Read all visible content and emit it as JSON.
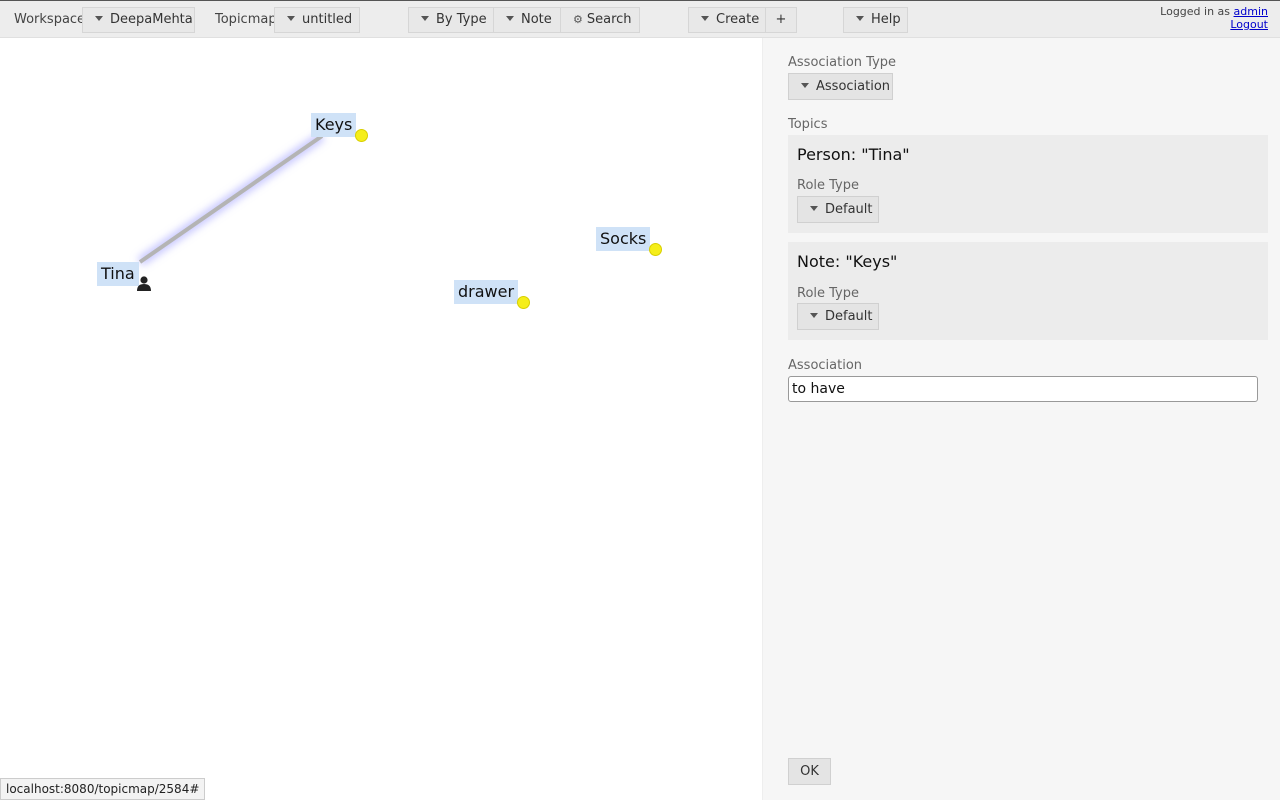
{
  "toolbar": {
    "workspace_label": "Workspace",
    "workspace_value": "DeepaMehta",
    "topicmap_label": "Topicmap",
    "topicmap_value": "untitled",
    "bytype_label": "By Type",
    "note_label": "Note",
    "search_label": "Search",
    "create_label": "Create",
    "plus_label": "+",
    "help_label": "Help",
    "logged_in_text": "Logged in as",
    "user_name": "admin",
    "logout_label": "Logout"
  },
  "canvas": {
    "topics": [
      {
        "label": "Keys",
        "icon": "note-dot-icon"
      },
      {
        "label": "Tina",
        "icon": "person-icon"
      },
      {
        "label": "Socks",
        "icon": "note-dot-icon"
      },
      {
        "label": "drawer",
        "icon": "note-dot-icon"
      }
    ]
  },
  "detail": {
    "assoc_type_label": "Association Type",
    "assoc_type_value": "Association",
    "topics_label": "Topics",
    "roles": [
      {
        "title": "Person: \"Tina\"",
        "role_type_label": "Role Type",
        "role_type_value": "Default"
      },
      {
        "title": "Note: \"Keys\"",
        "role_type_label": "Role Type",
        "role_type_value": "Default"
      }
    ],
    "association_label": "Association",
    "association_value": "to have",
    "ok_label": "OK"
  },
  "status": {
    "url": "localhost:8080/topicmap/2584#"
  },
  "colors": {
    "topic_label_bg": "#cfe2f7",
    "note_dot": "#f5ee1a",
    "edge": "#b4b4b4",
    "edge_glow": "#9a9aff",
    "link": "#0000cc"
  }
}
